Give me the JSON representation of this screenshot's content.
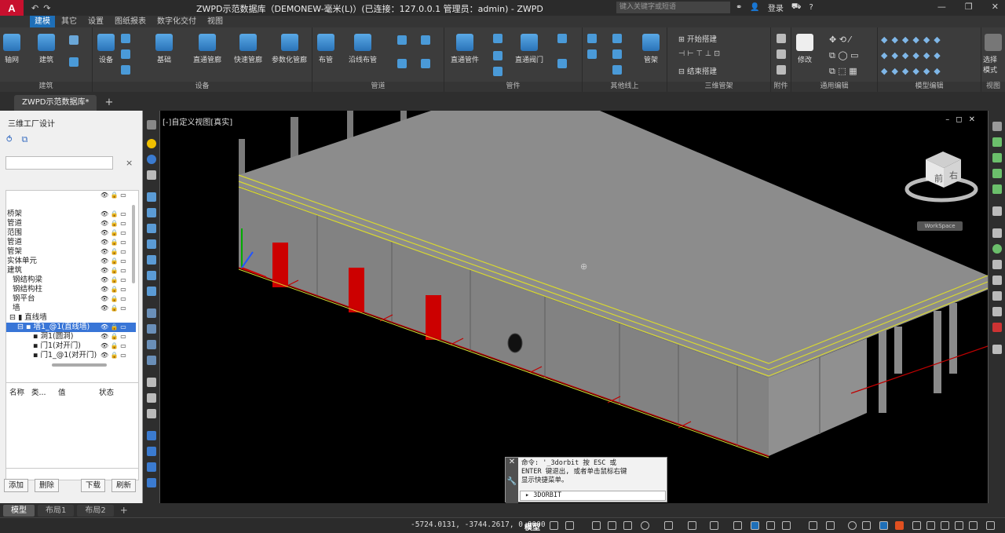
{
  "app": {
    "logo_text": "A",
    "title": "ZWPD示范数据库（DEMONEW-毫米(L)）(已连接：127.0.0.1 管理员：admin) - ZWPD",
    "search_placeholder": "键入关键字或短语",
    "login_label": "登录"
  },
  "ribbon_tabs": [
    "建模",
    "其它",
    "设置",
    "图纸报表",
    "数字化交付",
    "视图"
  ],
  "ribbon_groups": [
    {
      "label": "建筑",
      "buttons": [
        "轴网",
        "建筑"
      ]
    },
    {
      "label": "设备",
      "buttons": [
        "设备",
        "基础",
        "直通管廊",
        "快速管廊",
        "参数化管廊"
      ]
    },
    {
      "label": "管道",
      "buttons": [
        "布管",
        "沿线布管"
      ]
    },
    {
      "label": "管件",
      "buttons": [
        "直通管件",
        "直通阀门"
      ]
    },
    {
      "label": "其他线上",
      "buttons": [
        "管架"
      ]
    },
    {
      "label": "三维管架",
      "buttons": [
        "开始搭建",
        "结束搭建"
      ]
    },
    {
      "label": "附件",
      "buttons": []
    },
    {
      "label": "通用编辑",
      "buttons": [
        "修改"
      ]
    },
    {
      "label": "模型编辑",
      "buttons": []
    },
    {
      "label": "视图",
      "buttons": [
        "选择模式"
      ]
    }
  ],
  "document_tab": "ZWPD示范数据库*",
  "left_panel": {
    "title": "三维工厂设计",
    "tree": [
      {
        "label": "",
        "indent": 0
      },
      {
        "label": "桥架",
        "indent": 0
      },
      {
        "label": "管道",
        "indent": 0
      },
      {
        "label": "范围",
        "indent": 0
      },
      {
        "label": "管道",
        "indent": 0
      },
      {
        "label": "管架",
        "indent": 0
      },
      {
        "label": "实体单元",
        "indent": 0
      },
      {
        "label": "建筑",
        "indent": 0
      },
      {
        "label": "钢结构梁",
        "indent": 1
      },
      {
        "label": "钢结构柱",
        "indent": 1
      },
      {
        "label": "钢平台",
        "indent": 1
      },
      {
        "label": "墙",
        "indent": 1
      },
      {
        "label": "直线墙",
        "indent": 1
      },
      {
        "label": "墙1_@1(直线墙)",
        "indent": 2,
        "selected": true
      },
      {
        "label": "洞1(圆洞)",
        "indent": 3
      },
      {
        "label": "门1(对开门)",
        "indent": 3
      },
      {
        "label": "门1_@1(对开门)",
        "indent": 3
      }
    ],
    "props_columns": [
      "名称",
      "类...",
      "值",
      "状态"
    ],
    "buttons": [
      "添加",
      "删除",
      "下载",
      "刷新"
    ]
  },
  "viewport": {
    "label": "[-]自定义视图[真实]",
    "viewcube_faces": [
      "前",
      "右"
    ],
    "workspace_label": "WorkSpace"
  },
  "command": {
    "history": "命令: '_3dorbit 按 ESC 或\nENTER 键退出, 或者单击鼠标右键\n显示快捷菜单。",
    "input": "3DORBIT"
  },
  "layout_tabs": [
    "模型",
    "布局1",
    "布局2"
  ],
  "status": {
    "coords": "-5724.0131, -3744.2617, 0.0000",
    "mode": "模型"
  },
  "colors": {
    "accent": "#1e6fb8",
    "wall": "#8a8a8a",
    "door": "#d00000",
    "railing": "#d8d830",
    "grid_red": "#c00000"
  }
}
